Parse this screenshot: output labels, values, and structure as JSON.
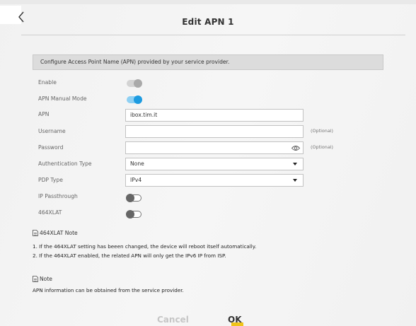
{
  "header": {
    "title": "Edit APN 1",
    "back_icon": "chevron-left-icon"
  },
  "banner": {
    "text": "Configure Access Point Name (APN) provided by your service provider."
  },
  "form": {
    "enable": {
      "label": "Enable",
      "state": "on-disabled"
    },
    "apn_manual_mode": {
      "label": "APN Manual Mode",
      "state": "on"
    },
    "apn": {
      "label": "APN",
      "value": "ibox.tim.it"
    },
    "username": {
      "label": "Username",
      "value": "",
      "hint": "(Optional)"
    },
    "password": {
      "label": "Password",
      "value": "",
      "hint": "(Optional)",
      "icon": "eye-icon"
    },
    "authentication_type": {
      "label": "Authentication Type",
      "value": "None"
    },
    "pdp_type": {
      "label": "PDP Type",
      "value": "IPv4"
    },
    "ip_passthrough": {
      "label": "IP Passthrough",
      "state": "off"
    },
    "xlat464": {
      "label": "464XLAT",
      "state": "off"
    }
  },
  "xlat_note": {
    "title": "464XLAT Note",
    "lines": [
      "1. If the 464XLAT setting has beeen changed, the device will reboot itself automatically.",
      "2. If the 464XLAT enabled, the related APN will only get the IPv6 IP from ISP."
    ]
  },
  "note": {
    "title": "Note",
    "text": "APN information can be obtained from the service provider."
  },
  "actions": {
    "cancel_label": "Cancel",
    "ok_label": "OK"
  },
  "colors": {
    "accent_blue": "#1d9be0",
    "ok_underline": "#f0c419",
    "banner_bg": "#dcdcdc"
  }
}
